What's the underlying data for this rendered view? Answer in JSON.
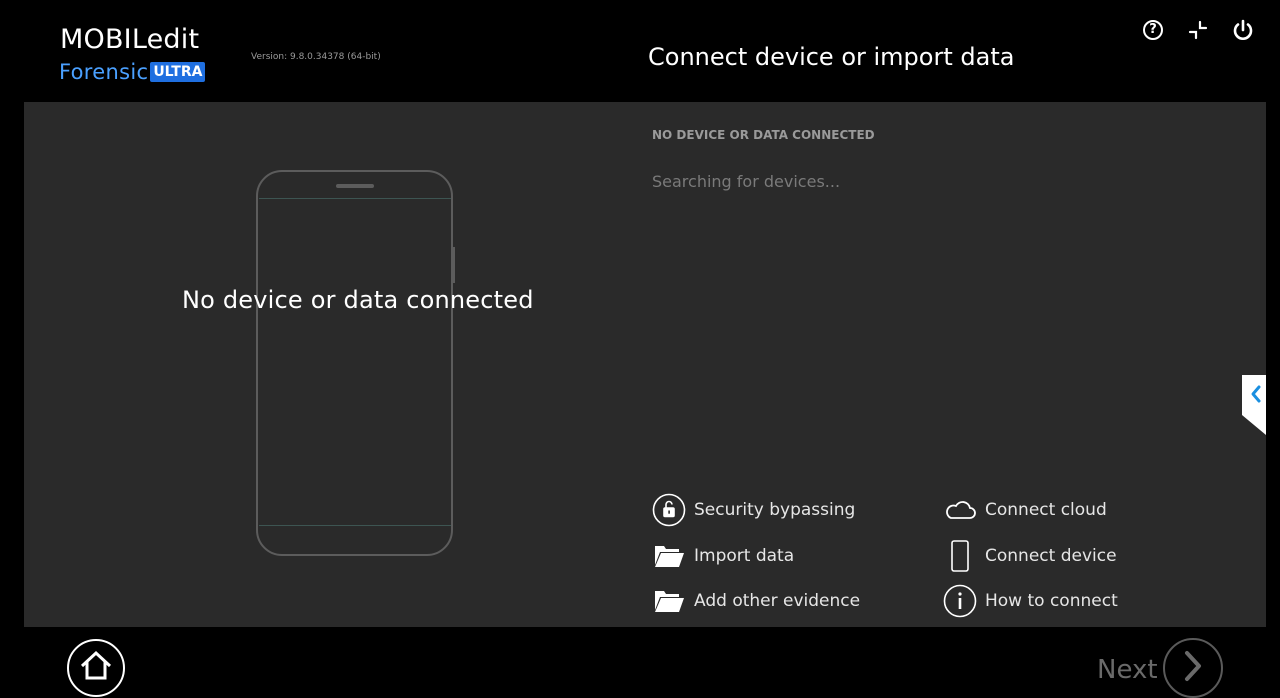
{
  "header": {
    "logo_title": "MOBILedit",
    "logo_subtitle": "Forensic",
    "logo_badge": "ULTRA",
    "version": "Version: 9.8.0.34378 (64-bit)",
    "page_title": "Connect device or import data",
    "icons": [
      "help-icon",
      "minimize-icon",
      "power-icon"
    ]
  },
  "device_preview": {
    "message": "No device or data connected"
  },
  "status": {
    "heading": "NO DEVICE OR DATA CONNECTED",
    "searching": "Searching for devices..."
  },
  "actions": [
    {
      "label": "Security bypassing",
      "icon": "unlock-icon"
    },
    {
      "label": "Import data",
      "icon": "folder-open-icon"
    },
    {
      "label": "Add other evidence",
      "icon": "folder-open-icon"
    },
    {
      "label": "Connect cloud",
      "icon": "cloud-icon"
    },
    {
      "label": "Connect device",
      "icon": "phone-icon"
    },
    {
      "label": "How to connect",
      "icon": "info-icon"
    }
  ],
  "footer": {
    "next_label": "Next"
  },
  "colors": {
    "background": "#000000",
    "panel": "#2a2a2a",
    "brand_blue": "#4aa0ff",
    "badge_blue": "#1f6fe0",
    "side_tab_arrow": "#1a8fe0"
  }
}
